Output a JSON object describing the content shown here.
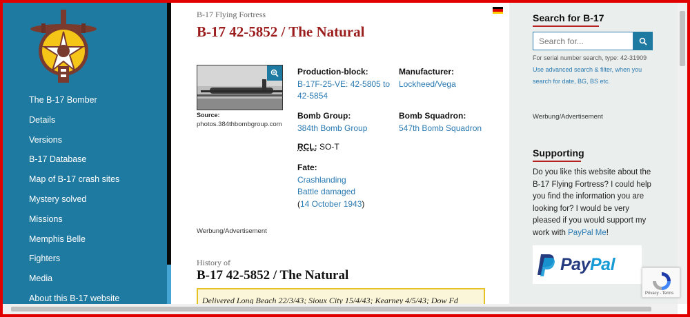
{
  "sidebar": {
    "nav": [
      "The B-17 Bomber",
      "Details",
      "Versions",
      "B-17 Database",
      "Map of B-17 crash sites",
      "Mystery solved",
      "Missions",
      "Memphis Belle",
      "Fighters",
      "Media",
      "About this B-17 website"
    ]
  },
  "main": {
    "kicker": "B-17 Flying Fortress",
    "title": "B-17 42-5852 / The Natural",
    "source_label": "Source:",
    "source_value": "photos.384thbombgroup.com",
    "production_label": "Production-block:",
    "production_value": "B-17F-25-VE: 42-5805 to 42-5854",
    "manufacturer_label": "Manufacturer:",
    "manufacturer_value": "Lockheed/Vega",
    "group_label": "Bomb Group:",
    "group_value": "384th Bomb Group",
    "squadron_label": "Bomb Squadron:",
    "squadron_value": "547th Bomb Squadron",
    "rcl_label": "RCL:",
    "rcl_value": " SO-T",
    "fate_label": "Fate:",
    "fate_1": "Crashlanding",
    "fate_2": "Battle damaged",
    "fate_date_open": "(",
    "fate_date": "14 October 1943",
    "fate_date_close": ")",
    "ad": "Werbung/Advertisement",
    "history_kicker": "History of",
    "history_title": "B-17 42-5852 / The Natural",
    "history_text": "Delivered Long Beach 22/3/43; Sioux City 15/4/43; Kearney 4/5/43; Dow Fd"
  },
  "right": {
    "search_title": "Search for B-17",
    "search_placeholder": "Search for...",
    "hint_1": "For serial number search, type: 42-31909",
    "hint_2": "Use advanced search & filter, when you",
    "hint_3": "search for date, BG, BS etc.",
    "ad": "Werbung/Advertisement",
    "support_title": "Supporting",
    "support_text": "Do you like this website about the B-17 Flying Fortress? I could help you find the information you are looking for? I would be very pleased if you would support my work with ",
    "paypal_link": "PayPal Me",
    "support_end": "!",
    "paypal_pay": "Pay",
    "paypal_pal": "Pal"
  },
  "recaptcha_links": "Privacy - Terms",
  "colors": {
    "sidebar": "#1f7aa1",
    "title": "#9b1d1d",
    "link": "#2a7ab2",
    "frame": "#e00000",
    "paypal_dark": "#253b80",
    "paypal_light": "#179bd7"
  }
}
